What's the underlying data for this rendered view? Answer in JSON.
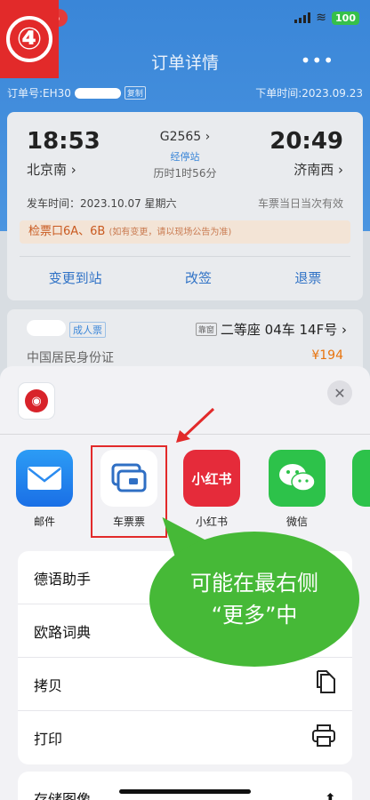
{
  "status_bar": {
    "badge": "5",
    "battery": "100"
  },
  "step_marker": "④",
  "nav": {
    "title": "订单详情",
    "more": "•••"
  },
  "order": {
    "number_prefix": "订单号:EH30",
    "copy": "复制",
    "order_time": "下单时间:2023.09.23"
  },
  "ticket": {
    "dep_time": "18:53",
    "arr_time": "20:49",
    "train_no": "G2565 ›",
    "via": "经停站",
    "duration": "历时1时56分",
    "dep_station": "北京南 ›",
    "arr_station": "济南西 ›",
    "dep_date": "发车时间：2023.10.07 星期六",
    "validity": "车票当日当次有效",
    "gate": "检票口6A、6B",
    "gate_note": "(如有变更，请以现场公告为准)",
    "actions": [
      "变更到站",
      "改签",
      "退票"
    ]
  },
  "passenger": {
    "ticket_type": "成人票",
    "window": "靠窗",
    "seat": "二等座 04车 14F号 ›",
    "id_type": "中国居民身份证",
    "price": "¥194"
  },
  "share_sheet": {
    "apps": [
      {
        "label": "邮件",
        "icon": "mail-icon"
      },
      {
        "label": "车票票",
        "icon": "ticket-app-icon"
      },
      {
        "label": "小红书",
        "icon": "xiaohongshu-icon",
        "tile_text": "小红书"
      },
      {
        "label": "微信",
        "icon": "wechat-icon"
      }
    ],
    "actions": [
      {
        "label": "德语助手",
        "icon": ""
      },
      {
        "label": "欧路词典",
        "icon": ""
      },
      {
        "label": "拷贝",
        "icon": "copy-icon"
      },
      {
        "label": "打印",
        "icon": "print-icon"
      }
    ],
    "partial_action": "存储图像"
  },
  "annotation": {
    "line1": "可能在最右侧",
    "line2": "“更多”中"
  },
  "colors": {
    "primary": "#3a86d8",
    "highlight": "#e22a2a",
    "bubble": "#46b937",
    "price": "#e8740e"
  }
}
